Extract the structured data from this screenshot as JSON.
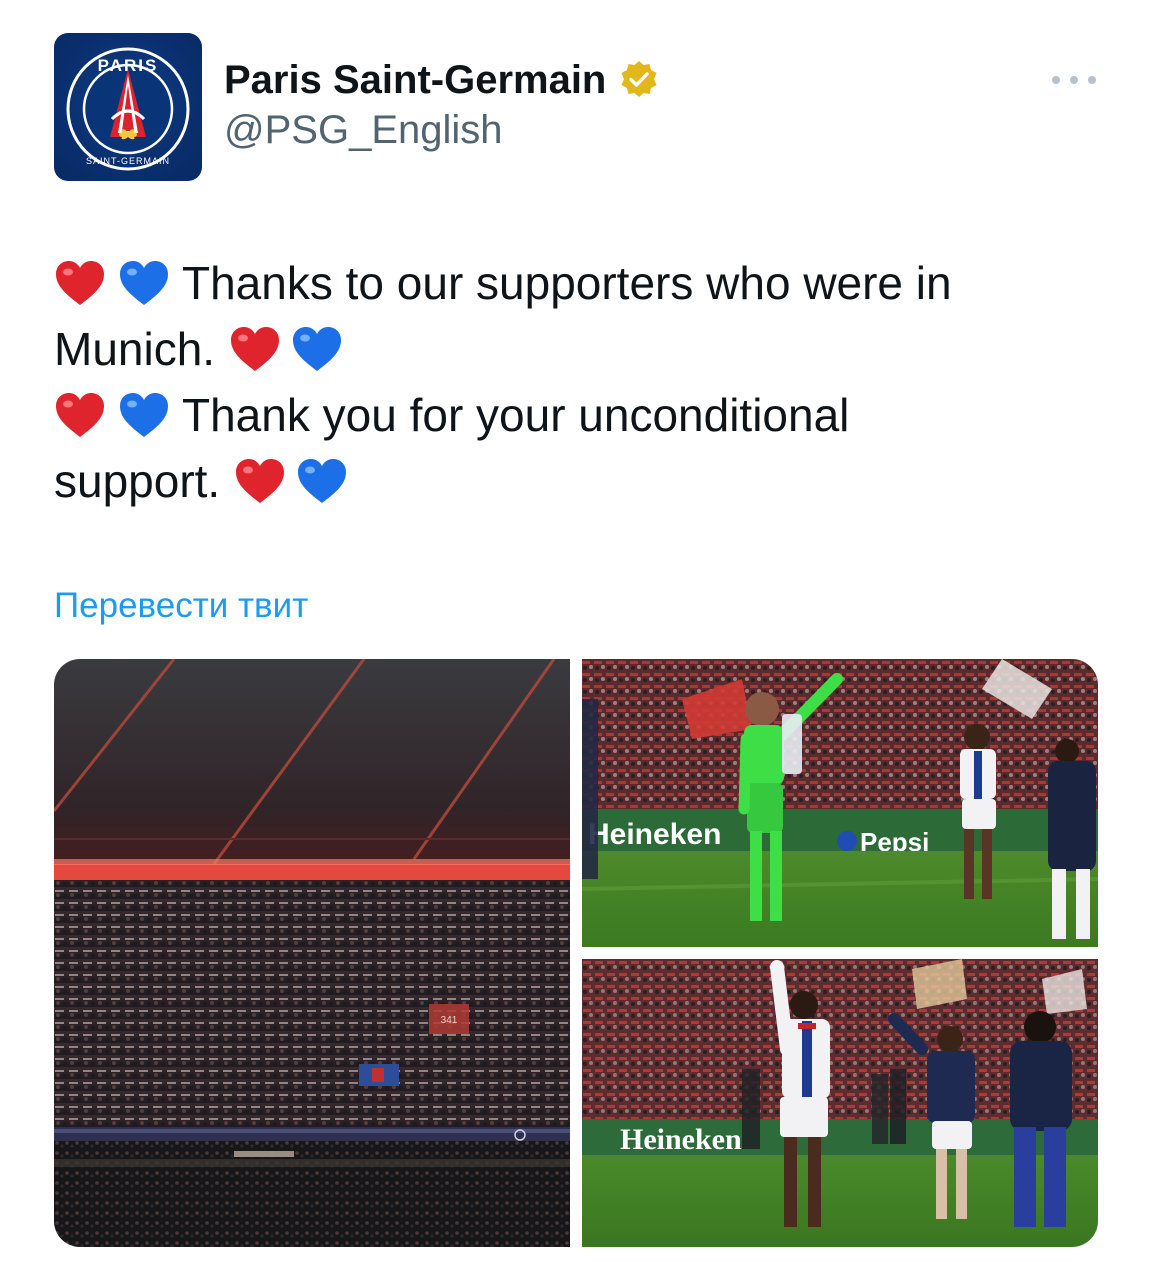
{
  "author": {
    "name": "Paris Saint-Germain",
    "handle": "@PSG_English",
    "verified": true,
    "avatar_logo_text": "PARIS SAINT-GERMAIN"
  },
  "tweet": {
    "lines": [
      {
        "before": "heart-pair",
        "text": "Thanks to our supporters who were in",
        "after": ""
      },
      {
        "before": "",
        "text": "Munich.",
        "after": "heart-pair"
      },
      {
        "before": "heart-pair",
        "text": "Thank you for your unconditional",
        "after": ""
      },
      {
        "before": "",
        "text": "support.",
        "after": "heart-pair"
      }
    ]
  },
  "translate_label": "Перевести твит",
  "media": {
    "photos": [
      {
        "name": "fans-stand-photo",
        "signage": "341"
      },
      {
        "name": "goalkeeper-applause-photo",
        "signage": [
          "Heineken",
          "Pepsi"
        ]
      },
      {
        "name": "players-wave-photo",
        "signage": [
          "Heineken"
        ]
      }
    ]
  },
  "icons": {
    "verified": "verified-badge-icon",
    "more": "more-options-icon",
    "red_heart": "red-heart-emoji",
    "blue_heart": "blue-heart-emoji"
  },
  "colors": {
    "text": "#0f1419",
    "secondary": "#536471",
    "link": "#1d9bf0",
    "verified_gold": "#e2b719",
    "heart_red": "#e0242e",
    "heart_blue": "#1d6fe8",
    "psg_navy": "#0a2f6e",
    "psg_red": "#d9232e"
  }
}
